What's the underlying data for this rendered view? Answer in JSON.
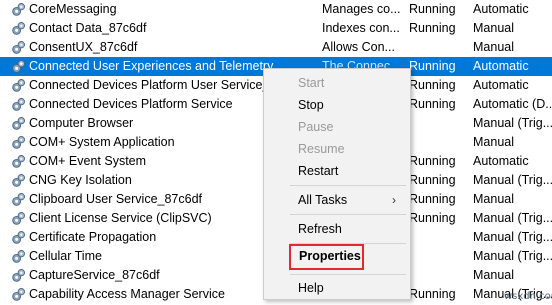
{
  "services": [
    {
      "name": "CoreMessaging",
      "description": "Manages co...",
      "status": "Running",
      "startup": "Automatic"
    },
    {
      "name": "Contact Data_87c6df",
      "description": "Indexes con...",
      "status": "Running",
      "startup": "Manual"
    },
    {
      "name": "ConsentUX_87c6df",
      "description": "Allows Con...",
      "status": "",
      "startup": "Manual"
    },
    {
      "name": "Connected User Experiences and Telemetry",
      "description": "The Connec...",
      "status": "Running",
      "startup": "Automatic",
      "selected": true
    },
    {
      "name": "Connected Devices Platform User Service_87c6df",
      "description": "",
      "status": "Running",
      "startup": "Automatic"
    },
    {
      "name": "Connected Devices Platform Service",
      "description": "",
      "status": "Running",
      "startup": "Automatic (D..."
    },
    {
      "name": "Computer Browser",
      "description": "",
      "status": "",
      "startup": "Manual (Trig..."
    },
    {
      "name": "COM+ System Application",
      "description": "",
      "status": "",
      "startup": "Manual"
    },
    {
      "name": "COM+ Event System",
      "description": "",
      "status": "Running",
      "startup": "Automatic"
    },
    {
      "name": "CNG Key Isolation",
      "description": "",
      "status": "Running",
      "startup": "Manual (Trig..."
    },
    {
      "name": "Clipboard User Service_87c6df",
      "description": "",
      "status": "Running",
      "startup": "Manual"
    },
    {
      "name": "Client License Service (ClipSVC)",
      "description": "",
      "status": "Running",
      "startup": "Manual (Trig..."
    },
    {
      "name": "Certificate Propagation",
      "description": "",
      "status": "",
      "startup": "Manual (Trig..."
    },
    {
      "name": "Cellular Time",
      "description": "",
      "status": "",
      "startup": "Manual (Trig..."
    },
    {
      "name": "CaptureService_87c6df",
      "description": "",
      "status": "",
      "startup": "Manual"
    },
    {
      "name": "Capability Access Manager Service",
      "description": "",
      "status": "Running",
      "startup": "Manual (Trig..."
    }
  ],
  "context_menu": {
    "items": [
      {
        "label": "Start",
        "enabled": false
      },
      {
        "label": "Stop",
        "enabled": true
      },
      {
        "label": "Pause",
        "enabled": false
      },
      {
        "label": "Resume",
        "enabled": false
      },
      {
        "label": "Restart",
        "enabled": true
      },
      {
        "label": "All Tasks",
        "enabled": true,
        "submenu": true
      },
      {
        "label": "Refresh",
        "enabled": true
      },
      {
        "label": "Properties",
        "enabled": true,
        "bold": true,
        "highlighted": true
      },
      {
        "label": "Help",
        "enabled": true
      }
    ],
    "submenu_arrow": "›"
  },
  "colors": {
    "selection": "#0078d7",
    "highlight_box": "#e32b2b"
  },
  "icons": {
    "service": "gear-icon"
  },
  "watermark": "wsxdn.com"
}
